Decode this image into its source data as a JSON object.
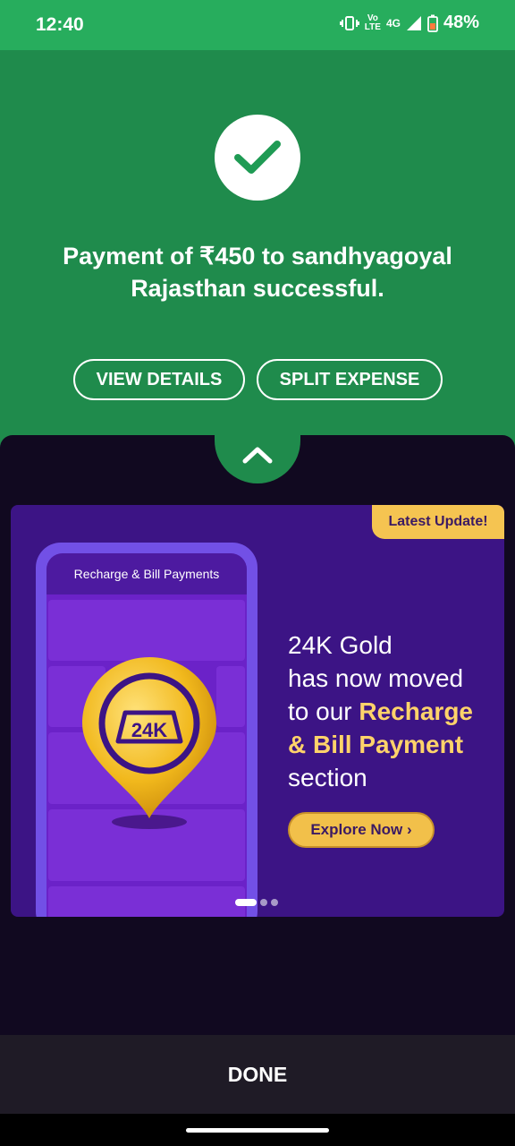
{
  "status_bar": {
    "time": "12:40",
    "net_vo": "Vo",
    "net_lte": "LTE",
    "net_4g": "4G",
    "battery": "48%"
  },
  "payment": {
    "message": "Payment of ₹450 to sandhyagoyal Rajasthan successful."
  },
  "actions": {
    "view_details": "VIEW DETAILS",
    "split_expense": "SPLIT EXPENSE"
  },
  "banner": {
    "tag": "Latest Update!",
    "phone_header": "Recharge & Bill Payments",
    "pin_label": "24K",
    "line1": "24K Gold",
    "line2": "has now moved",
    "line3_prefix": "to our ",
    "line3_bold": "Recharge",
    "line4_bold": "& Bill Payment",
    "line5": "section",
    "cta": "Explore Now ›",
    "carousel_page": 1,
    "carousel_total": 3
  },
  "footer": {
    "done_label": "DONE"
  },
  "colors": {
    "success_green": "#1f8b4c",
    "status_green": "#27ad5d",
    "banner_purple": "#3c1485",
    "gold": "#f2c04a"
  }
}
